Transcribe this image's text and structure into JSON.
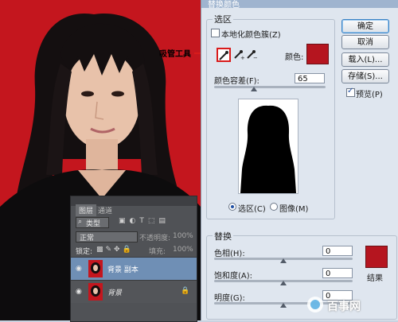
{
  "dialog": {
    "title": "替换颜色"
  },
  "selection": {
    "legend": "选区",
    "localized_label": "本地化颜色簇(Z)",
    "color_label": "颜色:",
    "tolerance_label": "颜色容差(F):",
    "tolerance_value": "65",
    "radio_selection": "选区(C)",
    "radio_image": "图像(M)",
    "selected_radio": "selection"
  },
  "buttons": {
    "ok": "确定",
    "cancel": "取消",
    "load": "载入(L)...",
    "save": "存储(S)...",
    "preview": "预览(P)"
  },
  "annotation": {
    "text": "吸管工具"
  },
  "replace": {
    "legend": "替换",
    "hue_label": "色相(H):",
    "hue_value": "0",
    "saturation_label": "饱和度(A):",
    "saturation_value": "0",
    "lightness_label": "明度(G):",
    "lightness_value": "0",
    "result_label": "结果"
  },
  "colors": {
    "selected_color": "#b5151f",
    "result_color": "#b5151f",
    "background_red": "#c4161e"
  },
  "layers_panel": {
    "tabs": [
      "图层",
      "通道"
    ],
    "kind": "类型",
    "blend_mode": "正常",
    "opacity_label": "不透明度:",
    "opacity_value": "100%",
    "lock_label": "锁定:",
    "fill_label": "填充:",
    "fill_value": "100%",
    "layers": [
      {
        "name": "背景 副本"
      },
      {
        "name": "背景"
      }
    ]
  },
  "watermark": {
    "text": "百事网"
  }
}
